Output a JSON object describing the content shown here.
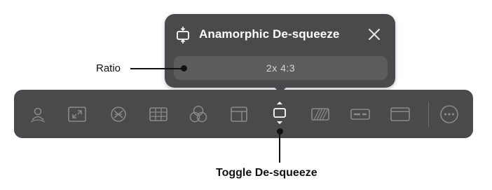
{
  "popover": {
    "icon": "desqueeze-icon",
    "title": "Anamorphic De-squeeze",
    "close_icon": "close-icon",
    "ratio_value": "2x 4:3"
  },
  "toolbar": {
    "buttons": [
      {
        "name": "portrait-lighting-icon"
      },
      {
        "name": "shrink-arrows-icon"
      },
      {
        "name": "no-filter-icon"
      },
      {
        "name": "grid-icon"
      },
      {
        "name": "color-circles-icon"
      },
      {
        "name": "frame-guides-icon"
      },
      {
        "name": "desqueeze-icon",
        "active": true
      },
      {
        "name": "zebra-stripes-icon"
      },
      {
        "name": "bar-indicator-icon"
      },
      {
        "name": "aspect-window-icon"
      },
      {
        "name": "more-icon"
      }
    ]
  },
  "callouts": {
    "ratio": "Ratio",
    "toggle": "Toggle De-squeeze"
  },
  "colors": {
    "panel": "#4a4a4c",
    "field": "#5c5c5e",
    "icon_dim": "#8a8a8c",
    "icon_active": "#ffffff"
  }
}
